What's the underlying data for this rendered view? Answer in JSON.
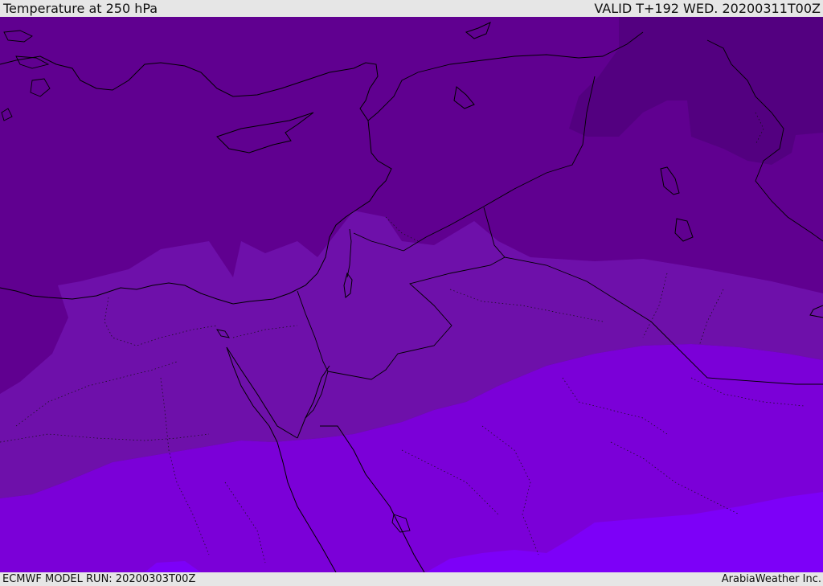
{
  "header": {
    "title": "Temperature at 250 hPa",
    "valid": "VALID T+192 WED. 20200311T00Z"
  },
  "footer": {
    "model_run": "ECMWF MODEL RUN: 20200303T00Z",
    "credit": "ArabiaWeather Inc."
  },
  "colors": {
    "band_coldest": "#530080",
    "band_cold": "#600090",
    "band_mid": "#6e10aa",
    "band_warm": "#7b00d8",
    "band_warmest": "#7d00f8",
    "coastline": "#000000",
    "background": "#e6e6e6"
  }
}
